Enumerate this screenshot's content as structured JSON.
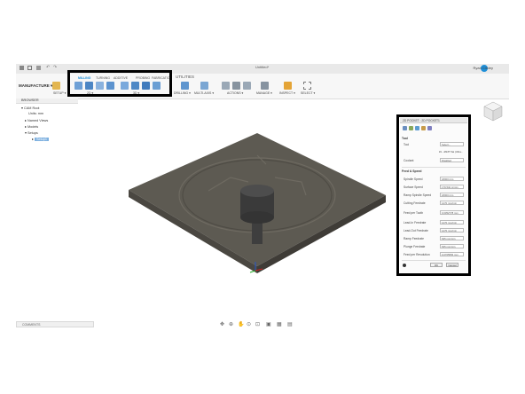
{
  "titlebar": {
    "document": "Untitled*",
    "user": "Ryan Clinley"
  },
  "toolbar": {
    "workspace": "MANUFACTURE ▾",
    "tabs": [
      "MILLING",
      "TURNING",
      "ADDITIVE",
      "PROBING",
      "FABRICATION",
      "UTILITIES"
    ],
    "groups": [
      "SETUP ▾",
      "2D ▾",
      "3D ▾",
      "DRILLING ▾",
      "MULTI-AXIS ▾",
      "ACTIONS ▾",
      "MANAGE ▾",
      "INSPECT ▾",
      "SELECT ▾"
    ]
  },
  "browser": {
    "header": "BROWSER",
    "items": [
      "CAM Root",
      "Units: mm",
      "Named Views",
      "Models",
      "Setups",
      "Setup1"
    ]
  },
  "comments": "COMMENTS",
  "panel": {
    "header": "2D POCKET : 2D POCKET1",
    "tool_section": "Tool",
    "tool_label": "Tool",
    "tool_select": "Select...",
    "tool_desc": "#1 - Ø1/8\" flat (Ultra...",
    "coolant_label": "Coolant",
    "coolant_value": "Disabled",
    "feed_section": "Feed & Speed",
    "rows": [
      {
        "label": "Spindle Speed",
        "value": "18000 rpm"
      },
      {
        "label": "Surface Speed",
        "value": "179.542 m/min"
      },
      {
        "label": "Ramp Spindle Speed",
        "value": "18000 rpm"
      },
      {
        "label": "Cutting Feedrate",
        "value": "1270 mm/min"
      },
      {
        "label": "Feed per Tooth",
        "value": "0.0352778 mm"
      },
      {
        "label": "Lead-In Feedrate",
        "value": "1270 mm/min"
      },
      {
        "label": "Lead-Out Feedrate",
        "value": "1270 mm/min"
      },
      {
        "label": "Ramp Feedrate",
        "value": "635 mm/min"
      },
      {
        "label": "Plunge Feedrate",
        "value": "635 mm/min"
      },
      {
        "label": "Feed per Revolution",
        "value": "0.0705556 mm"
      }
    ],
    "ok": "OK",
    "cancel": "Cancel"
  },
  "colors": {
    "accent": "#1e8fd8",
    "stock": "#5d5a52",
    "highlight": "#000000"
  }
}
